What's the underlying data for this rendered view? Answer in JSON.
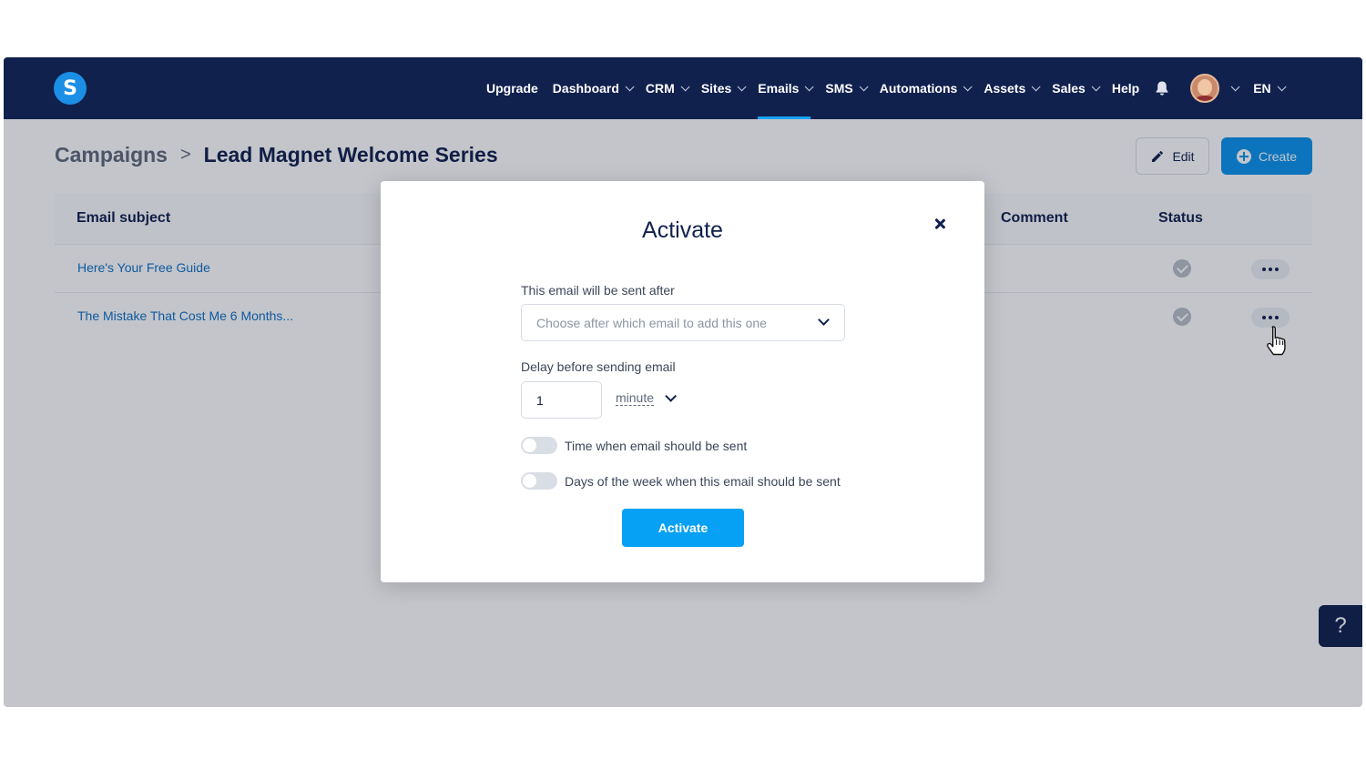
{
  "navbar": {
    "logo_letter": "S",
    "items": [
      {
        "label": "Upgrade",
        "dropdown": false
      },
      {
        "label": "Dashboard",
        "dropdown": true
      },
      {
        "label": "CRM",
        "dropdown": true
      },
      {
        "label": "Sites",
        "dropdown": true
      },
      {
        "label": "Emails",
        "dropdown": true,
        "active": true
      },
      {
        "label": "SMS",
        "dropdown": true
      },
      {
        "label": "Automations",
        "dropdown": true
      },
      {
        "label": "Assets",
        "dropdown": true
      },
      {
        "label": "Sales",
        "dropdown": true
      },
      {
        "label": "Help",
        "dropdown": false
      }
    ],
    "language": "EN"
  },
  "breadcrumb": {
    "parent": "Campaigns",
    "separator": ">",
    "current": "Lead Magnet Welcome Series"
  },
  "actions": {
    "edit_label": "Edit",
    "create_label": "Create"
  },
  "table": {
    "columns": {
      "subject": "Email subject",
      "comment": "Comment",
      "status": "Status"
    },
    "rows": [
      {
        "subject": "Here's Your Free Guide",
        "status": "active"
      },
      {
        "subject": "The Mistake That Cost Me 6 Months...",
        "status": "active"
      }
    ]
  },
  "modal": {
    "title": "Activate",
    "sent_after_label": "This email will be sent after",
    "sent_after_placeholder": "Choose after which email to add this one",
    "delay_label": "Delay before sending email",
    "delay_value": "1",
    "delay_unit": "minute",
    "toggle_time_label": "Time when email should be sent",
    "toggle_time_on": false,
    "toggle_days_label": "Days of the week when this email should be sent",
    "toggle_days_on": false,
    "activate_button": "Activate"
  },
  "help_fab": "?",
  "colors": {
    "navbar": "#10214e",
    "accent": "#06a0f5",
    "link": "#0f6fc6"
  }
}
